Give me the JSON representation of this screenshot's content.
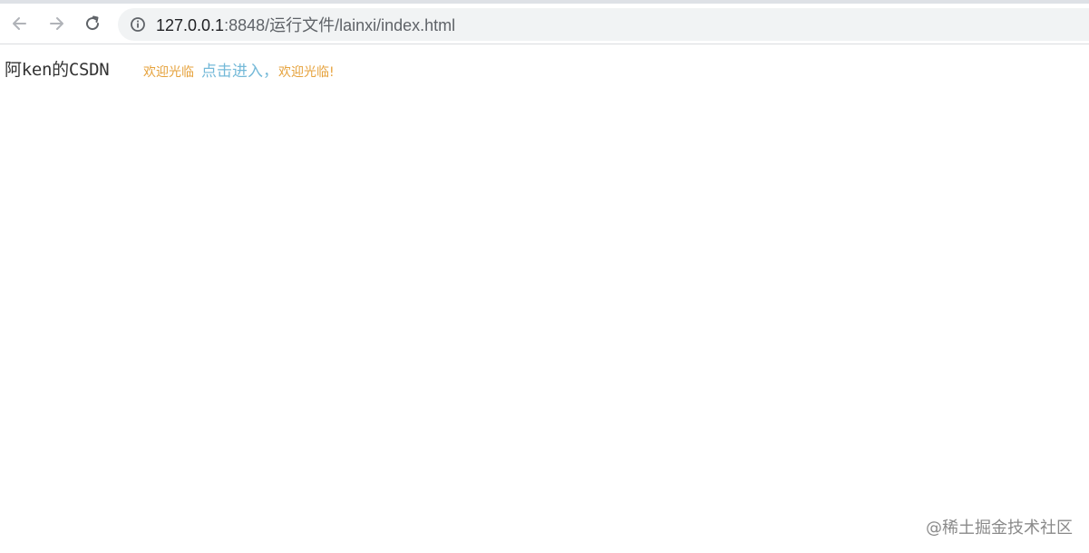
{
  "browser": {
    "url_host": "127.0.0.1",
    "url_path": ":8848/运行文件/lainxi/index.html",
    "icons": {
      "back": "arrow-left-icon",
      "forward": "arrow-right-icon",
      "reload": "reload-icon",
      "info": "info-icon"
    }
  },
  "page": {
    "site_title": "阿ken的CSDN",
    "welcome_left": "欢迎光临",
    "enter_link": "点击进入，",
    "welcome_right": "欢迎光临!"
  },
  "watermark": "@稀土掘金技术社区",
  "colors": {
    "welcome_text": "#e6a23c",
    "link_text": "#74b9d8",
    "title_text": "#333333"
  }
}
